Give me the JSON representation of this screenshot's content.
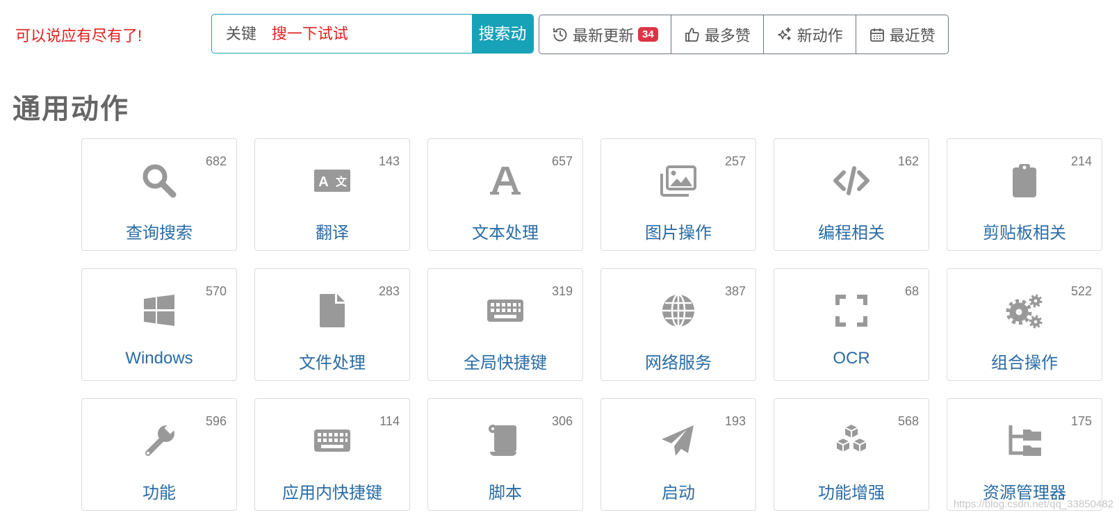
{
  "header": {
    "tagline": "可以说应有尽有了!",
    "search": {
      "prefix": "关键词",
      "placeholder": "搜一下试试",
      "value": "",
      "button_label": "搜索动作"
    },
    "filters": [
      {
        "label": "最新更新",
        "icon": "history-icon",
        "badge": "34"
      },
      {
        "label": "最多赞",
        "icon": "thumbs-up-icon"
      },
      {
        "label": "新动作",
        "icon": "stars-icon"
      },
      {
        "label": "最近赞",
        "icon": "calendar-icon"
      }
    ]
  },
  "section": {
    "title": "通用动作",
    "cards": [
      {
        "label": "查询搜索",
        "count": "682",
        "icon": "search-icon"
      },
      {
        "label": "翻译",
        "count": "143",
        "icon": "translate-icon"
      },
      {
        "label": "文本处理",
        "count": "657",
        "icon": "font-icon"
      },
      {
        "label": "图片操作",
        "count": "257",
        "icon": "images-icon"
      },
      {
        "label": "编程相关",
        "count": "162",
        "icon": "code-icon"
      },
      {
        "label": "剪贴板相关",
        "count": "214",
        "icon": "clipboard-icon"
      },
      {
        "label": "Windows",
        "count": "570",
        "icon": "windows-icon"
      },
      {
        "label": "文件处理",
        "count": "283",
        "icon": "file-icon"
      },
      {
        "label": "全局快捷键",
        "count": "319",
        "icon": "keyboard-icon"
      },
      {
        "label": "网络服务",
        "count": "387",
        "icon": "globe-icon"
      },
      {
        "label": "OCR",
        "count": "68",
        "icon": "expand-icon"
      },
      {
        "label": "组合操作",
        "count": "522",
        "icon": "gears-icon"
      },
      {
        "label": "功能",
        "count": "596",
        "icon": "wrench-icon"
      },
      {
        "label": "应用内快捷键",
        "count": "114",
        "icon": "keyboard-icon"
      },
      {
        "label": "脚本",
        "count": "306",
        "icon": "scroll-icon"
      },
      {
        "label": "启动",
        "count": "193",
        "icon": "paper-plane-icon"
      },
      {
        "label": "功能增强",
        "count": "568",
        "icon": "cubes-icon"
      },
      {
        "label": "资源管理器",
        "count": "175",
        "icon": "folder-tree-icon"
      }
    ]
  },
  "watermark": "https://blog.csdn.net/qq_33850482",
  "colors": {
    "accent": "#17a2b8",
    "tagline": "#e02020",
    "link": "#2a6ca5",
    "icon": "#999999",
    "badge": "#dc3545"
  }
}
